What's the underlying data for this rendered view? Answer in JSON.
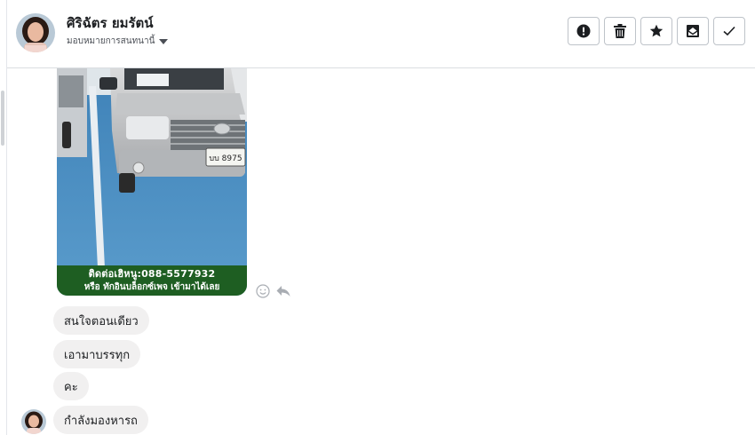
{
  "header": {
    "contact_name": "ศิริฉัตร ยมรัตน์",
    "assign_label": "มอบหมายการสนทนานี้",
    "actions": [
      {
        "name": "report-button",
        "icon": "exclamation-circle-icon"
      },
      {
        "name": "delete-button",
        "icon": "trash-icon"
      },
      {
        "name": "star-button",
        "icon": "star-icon"
      },
      {
        "name": "mark-unread-button",
        "icon": "envelope-icon"
      },
      {
        "name": "done-button",
        "icon": "check-icon"
      }
    ]
  },
  "photo": {
    "plate_text": "บบ 8975",
    "caption_line1": "ติดต่อเฮิหนู:088-5577932",
    "caption_line2": "หรือ ทักอินบล็อกซ์เพจ เข้ามาได้เลย"
  },
  "messages": [
    {
      "text": "สนใจตอนเดียว"
    },
    {
      "text": "เอามาบรรทุก"
    },
    {
      "text": "คะ"
    },
    {
      "text": "กำลังมองหารถ"
    }
  ],
  "colors": {
    "caption_bg": "#1e5e22",
    "bubble_bg": "#f1f0f0",
    "border": "#bec3c9"
  }
}
